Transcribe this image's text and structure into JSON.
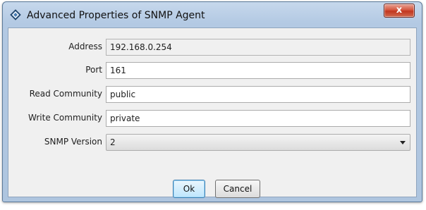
{
  "window": {
    "title": "Advanced Properties of SNMP Agent",
    "close_label": "x"
  },
  "form": {
    "address": {
      "label": "Address",
      "value": "192.168.0.254"
    },
    "port": {
      "label": "Port",
      "value": "161"
    },
    "read_community": {
      "label": "Read Community",
      "value": "public"
    },
    "write_community": {
      "label": "Write Community",
      "value": "private"
    },
    "snmp_version": {
      "label": "SNMP Version",
      "selected": "2"
    }
  },
  "buttons": {
    "ok_label": "Ok",
    "cancel_label": "Cancel"
  },
  "icons": {
    "app": "snmp-diamond-icon",
    "close": "close-icon",
    "dropdown": "chevron-down-icon"
  }
}
